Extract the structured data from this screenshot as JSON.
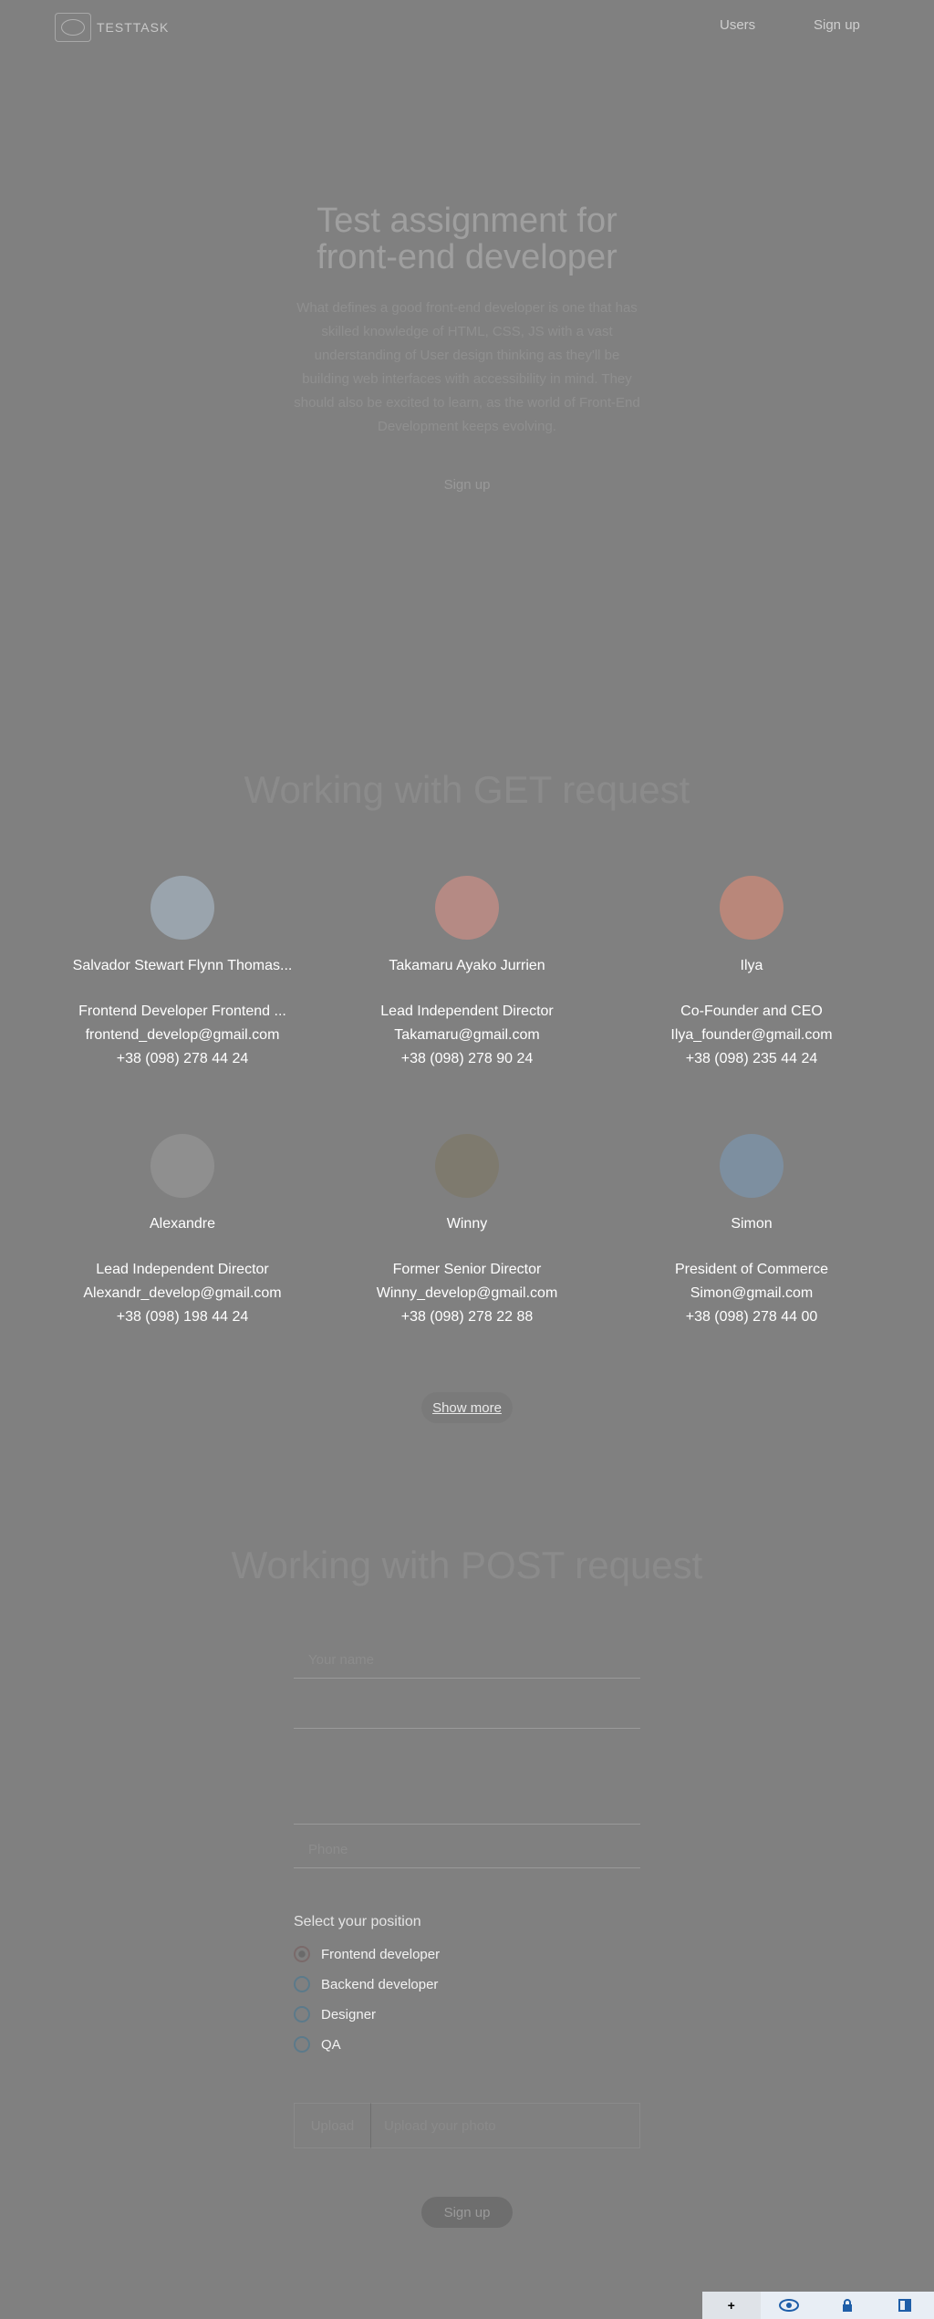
{
  "header": {
    "logo_text": "TESTTASK",
    "nav": [
      "Users",
      "Sign up"
    ]
  },
  "hero": {
    "title_line1": "Test assignment for",
    "title_line2": "front-end developer",
    "text": "What defines a good front-end developer is one that has skilled knowledge of HTML, CSS, JS with a vast understanding of User design thinking as they'll be building web interfaces with accessibility in mind. They should also be excited to learn, as the world of Front-End Development keeps evolving.",
    "button": "Sign up"
  },
  "users_section": {
    "title": "Working with GET request",
    "show_more": "Show more",
    "cards": [
      {
        "name": "Salvador Stewart Flynn Thomas...",
        "position": "Frontend Developer Frontend ...",
        "email": "frontend_develop@gmail.com",
        "phone": "+38 (098) 278 44 24",
        "avatar_color": "#9aa4ad"
      },
      {
        "name": "Takamaru Ayako Jurrien",
        "position": "Lead Independent Director",
        "email": "Takamaru@gmail.com",
        "phone": "+38 (098) 278 90 24",
        "avatar_color": "#b58a84"
      },
      {
        "name": "Ilya",
        "position": "Co-Founder and CEO",
        "email": "Ilya_founder@gmail.com",
        "phone": "+38 (098) 235 44 24",
        "avatar_color": "#b9877a"
      },
      {
        "name": "Alexandre",
        "position": "Lead Independent Director",
        "email": "Alexandr_develop@gmail.com",
        "phone": "+38 (098) 198 44 24",
        "avatar_color": "#8f8f8f"
      },
      {
        "name": "Winny",
        "position": "Former Senior Director",
        "email": "Winny_develop@gmail.com",
        "phone": "+38 (098) 278 22 88",
        "avatar_color": "#7e7a6e"
      },
      {
        "name": "Simon",
        "position": "President of Commerce",
        "email": "Simon@gmail.com",
        "phone": "+38 (098) 278 44 00",
        "avatar_color": "#7d8fa0"
      }
    ]
  },
  "form_section": {
    "title": "Working with POST request",
    "name_placeholder": "Your name",
    "email_placeholder": "",
    "phone_placeholder": "Phone",
    "select_label": "Select your position",
    "positions": [
      "Frontend developer",
      "Backend developer",
      "Designer",
      "QA"
    ],
    "upload_button": "Upload",
    "upload_hint": "Upload your photo",
    "submit": "Sign up"
  },
  "toolbar": {
    "items": [
      "+",
      "eye-icon",
      "lock-icon",
      "panel-icon"
    ]
  }
}
